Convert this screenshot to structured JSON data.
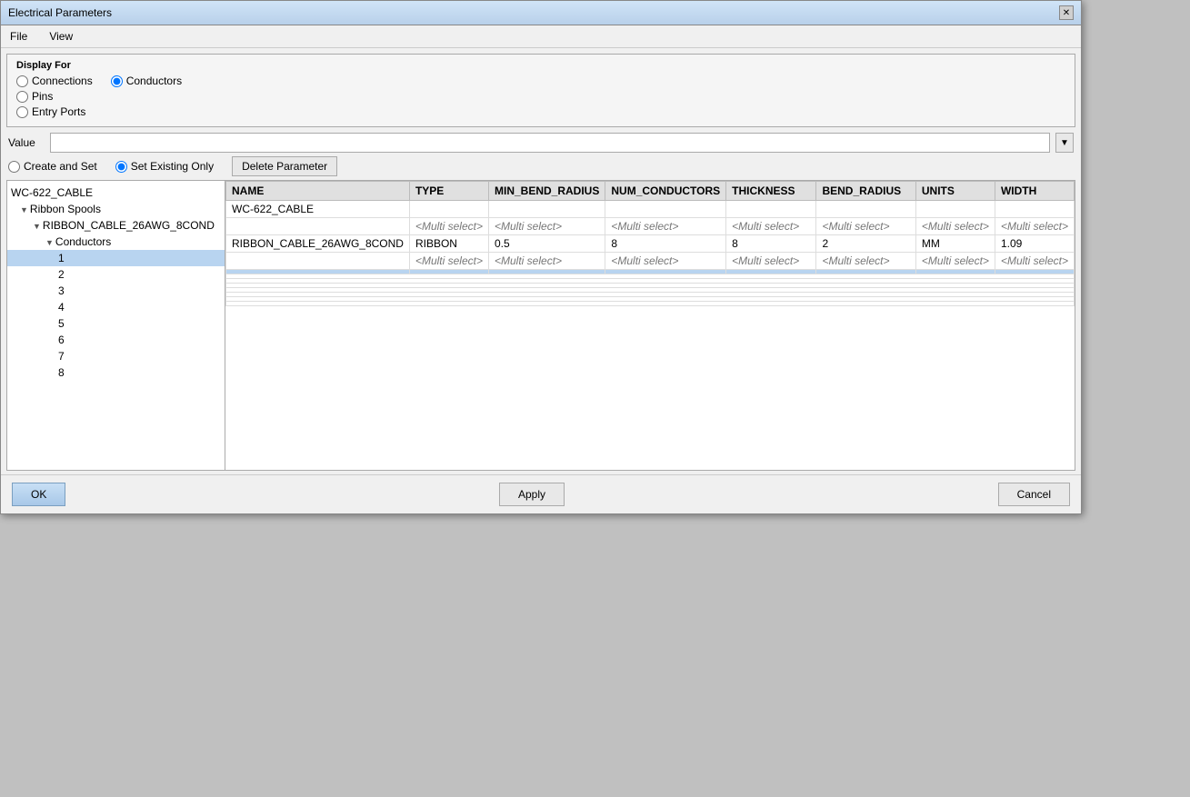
{
  "window": {
    "title": "Electrical Parameters",
    "close_label": "✕"
  },
  "menu": {
    "file_label": "File",
    "view_label": "View"
  },
  "display_for": {
    "label": "Display For",
    "options": [
      {
        "id": "connections",
        "label": "Connections",
        "checked": true
      },
      {
        "id": "pins",
        "label": "Pins",
        "checked": false
      },
      {
        "id": "conductors",
        "label": "Conductors",
        "checked": false
      },
      {
        "id": "entry_ports",
        "label": "Entry Ports",
        "checked": false
      }
    ]
  },
  "parameter_mode": {
    "create_and_set": "Create and Set",
    "set_existing_only": "Set Existing Only",
    "selected": "set_existing_only"
  },
  "value_field": {
    "label": "Value",
    "placeholder": "",
    "dropdown_arrow": "▼"
  },
  "delete_button": "Delete Parameter",
  "table": {
    "columns": [
      "NAME",
      "TYPE",
      "MIN_BEND_RADIUS",
      "NUM_CONDUCTORS",
      "THICKNESS",
      "BEND_RADIUS",
      "UNITS",
      "WIDTH"
    ],
    "multi_select": "<Multi select>",
    "rows": [
      {
        "level": "root",
        "label": "WC-622_CABLE",
        "has_triangle": false,
        "name": "WC-622_CABLE",
        "type": "",
        "min_bend_radius": "",
        "num_conductors": "",
        "thickness": "",
        "bend_radius": "",
        "units": "",
        "width": ""
      },
      {
        "level": "l1",
        "label": "Ribbon Spools",
        "has_triangle": true,
        "direction": "down",
        "name": "",
        "type": "<Multi select>",
        "min_bend_radius": "<Multi select>",
        "num_conductors": "<Multi select>",
        "thickness": "<Multi select>",
        "bend_radius": "<Multi select>",
        "units": "<Multi select>",
        "width": "<Multi select>"
      },
      {
        "level": "l2",
        "label": "RIBBON_CABLE_26AWG_8COND",
        "has_triangle": true,
        "direction": "down",
        "name": "RIBBON_CABLE_26AWG_8COND",
        "type": "RIBBON",
        "min_bend_radius": "0.5",
        "num_conductors": "8",
        "thickness": "8",
        "bend_radius": "2",
        "units": "MM",
        "width": "1.09"
      },
      {
        "level": "l3",
        "label": "Conductors",
        "has_triangle": true,
        "direction": "down",
        "name": "",
        "type": "<Multi select>",
        "min_bend_radius": "<Multi select>",
        "num_conductors": "<Multi select>",
        "thickness": "<Multi select>",
        "bend_radius": "<Multi select>",
        "units": "<Multi select>",
        "width": "<Multi select>"
      },
      {
        "level": "l4",
        "label": "1",
        "selected": true,
        "has_triangle": false,
        "name": "",
        "type": "",
        "min_bend_radius": "",
        "num_conductors": "",
        "thickness": "",
        "bend_radius": "",
        "units": "",
        "width": ""
      },
      {
        "level": "l4",
        "label": "2",
        "has_triangle": false,
        "name": "",
        "type": "",
        "min_bend_radius": "",
        "num_conductors": "",
        "thickness": "",
        "bend_radius": "",
        "units": "",
        "width": ""
      },
      {
        "level": "l4",
        "label": "3",
        "has_triangle": false,
        "name": "",
        "type": "",
        "min_bend_radius": "",
        "num_conductors": "",
        "thickness": "",
        "bend_radius": "",
        "units": "",
        "width": ""
      },
      {
        "level": "l4",
        "label": "4",
        "has_triangle": false,
        "name": "",
        "type": "",
        "min_bend_radius": "",
        "num_conductors": "",
        "thickness": "",
        "bend_radius": "",
        "units": "",
        "width": ""
      },
      {
        "level": "l4",
        "label": "5",
        "has_triangle": false,
        "name": "",
        "type": "",
        "min_bend_radius": "",
        "num_conductors": "",
        "thickness": "",
        "bend_radius": "",
        "units": "",
        "width": ""
      },
      {
        "level": "l4",
        "label": "6",
        "has_triangle": false,
        "name": "",
        "type": "",
        "min_bend_radius": "",
        "num_conductors": "",
        "thickness": "",
        "bend_radius": "",
        "units": "",
        "width": ""
      },
      {
        "level": "l4",
        "label": "7",
        "has_triangle": false,
        "name": "",
        "type": "",
        "min_bend_radius": "",
        "num_conductors": "",
        "thickness": "",
        "bend_radius": "",
        "units": "",
        "width": ""
      },
      {
        "level": "l4",
        "label": "8",
        "has_triangle": false,
        "name": "",
        "type": "",
        "min_bend_radius": "",
        "num_conductors": "",
        "thickness": "",
        "bend_radius": "",
        "units": "",
        "width": ""
      }
    ]
  },
  "footer": {
    "ok_label": "OK",
    "apply_label": "Apply",
    "cancel_label": "Cancel"
  }
}
